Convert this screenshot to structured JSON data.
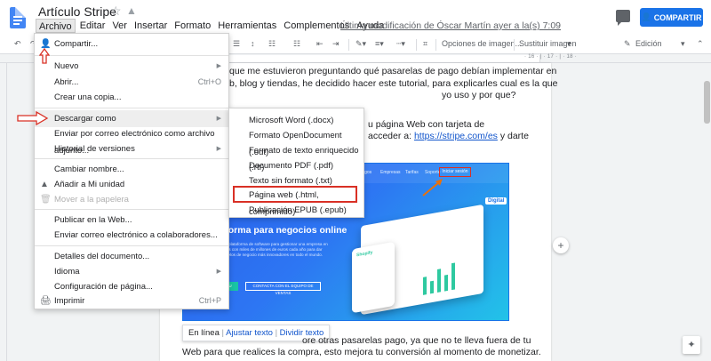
{
  "app": {
    "doc_title": "Artículo Stripe",
    "last_edit": "Última modificación de Óscar Martín ayer a la(s) 7:09",
    "share_label": "COMPARTIR"
  },
  "menubar": [
    "Archivo",
    "Editar",
    "Ver",
    "Insertar",
    "Formato",
    "Herramientas",
    "Complementos",
    "Ayuda"
  ],
  "toolbar": {
    "image_options": "Opciones de imagen...",
    "replace_image": "Sustituir imagen",
    "mode": "Edición"
  },
  "ruler_numbers": "· 16 · | · 17 · | · 18 ·",
  "document": {
    "line1": "que me estuvieron preguntando qué pasarelas de pago debían implementar en",
    "line2": "b, blog y tiendas, he decidido hacer este tutorial, para explicarles cual es la que",
    "line3": "yo uso y por que?",
    "line4": "u página Web con tarjeta de",
    "line5_pre": "acceder a: ",
    "line5_link": "https://stripe.com/es",
    "line5_post": " y darte",
    "line6": "ore otras pasarelas pago, ya que no te lleva fuera de tu",
    "line7": "Web para que realices la compra, esto mejora tu conversión al momento de monetizar."
  },
  "image": {
    "nav": [
      "Pagos",
      "Empresas",
      "Tarifas",
      "Soporte"
    ],
    "nav_button": "Iniciar sesión",
    "headline": "a plataforma para negocios online",
    "para": "Stripe es la mejor plataforma de software para gestionar una empresa en Internet. Operamos con miles de millones de euros cada año para dar soporte a los modelos de negocio más innovadores en todo el mundo.",
    "btn1": "EMPIEZA YA TU CUENTA",
    "btn2": "CONTACTA CON EL EQUIPO DE VENTAS",
    "laptop_brand": "Digital",
    "phone_brand": "Shopify"
  },
  "image_caption": {
    "inline": "En línea",
    "adjust": "Ajustar texto",
    "break": "Dividir texto"
  },
  "file_menu": [
    {
      "label": "Compartir...",
      "icon": "share-person-icon"
    },
    {
      "label": "Nuevo",
      "arrow": true
    },
    {
      "label": "Abrir...",
      "shortcut": "Ctrl+O"
    },
    {
      "label": "Crear una copia..."
    },
    {
      "label": "Descargar como",
      "arrow": true,
      "highlighted": true
    },
    {
      "label": "Enviar por correo electrónico como archivo adjunto..."
    },
    {
      "label": "Historial de versiones",
      "arrow": true
    },
    {
      "label": "Cambiar nombre..."
    },
    {
      "label": "Añadir a Mi unidad",
      "icon": "drive-icon"
    },
    {
      "label": "Mover a la papelera",
      "icon": "trash-icon",
      "disabled": true
    },
    {
      "label": "Publicar en la Web..."
    },
    {
      "label": "Enviar correo electrónico a colaboradores..."
    },
    {
      "label": "Detalles del documento..."
    },
    {
      "label": "Idioma",
      "arrow": true
    },
    {
      "label": "Configuración de página..."
    },
    {
      "label": "Imprimir",
      "shortcut": "Ctrl+P",
      "icon": "printer-icon"
    }
  ],
  "download_menu": [
    "Microsoft Word (.docx)",
    "Formato OpenDocument (.odt)",
    "Formato de texto enriquecido (.rtf)",
    "Documento PDF (.pdf)",
    "Texto sin formato (.txt)",
    "Página web (.html, comprimido)",
    "Publicación EPUB (.epub)"
  ],
  "colors": {
    "accent": "#1a73e8",
    "annotation_red": "#d93025",
    "link": "#1155cc"
  }
}
